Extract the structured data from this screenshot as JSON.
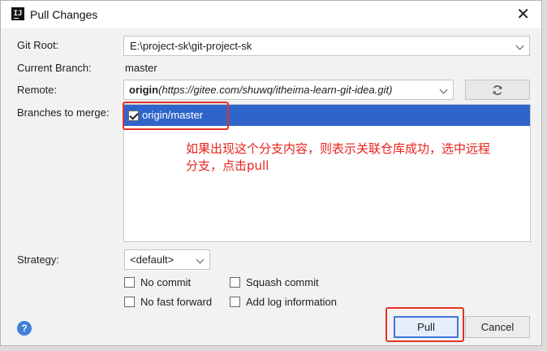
{
  "window": {
    "title": "Pull Changes",
    "close_glyph": "✕"
  },
  "fields": {
    "git_root_label": "Git Root:",
    "git_root_value": "E:\\project-sk\\git-project-sk",
    "current_branch_label": "Current Branch:",
    "current_branch_value": "master",
    "remote_label": "Remote:",
    "remote_name": "origin",
    "remote_url": "(https://gitee.com/shuwq/itheima-learn-git-idea.git)",
    "branches_label": "Branches to merge:"
  },
  "branches": [
    {
      "name": "origin/master",
      "checked": true,
      "selected": true
    }
  ],
  "annotation": {
    "line1": "如果出现这个分支内容，则表示关联仓库成功，选中远程",
    "line2": "分支，点击pull",
    "color": "#e8231c"
  },
  "strategy": {
    "label": "Strategy:",
    "value": "<default>"
  },
  "options": {
    "no_commit": {
      "label": "No commit",
      "checked": false
    },
    "squash_commit": {
      "label": "Squash commit",
      "checked": false
    },
    "no_fast_forward": {
      "label": "No fast forward",
      "checked": false
    },
    "add_log_information": {
      "label": "Add log information",
      "checked": false
    }
  },
  "buttons": {
    "help_glyph": "?",
    "pull": "Pull",
    "cancel": "Cancel"
  },
  "icons": {
    "app": "intellij-icon",
    "refresh": "refresh-icon",
    "help": "help-icon"
  },
  "colors": {
    "selection": "#2f65ca",
    "highlight_box": "#e53222",
    "help": "#3f7fd9"
  }
}
